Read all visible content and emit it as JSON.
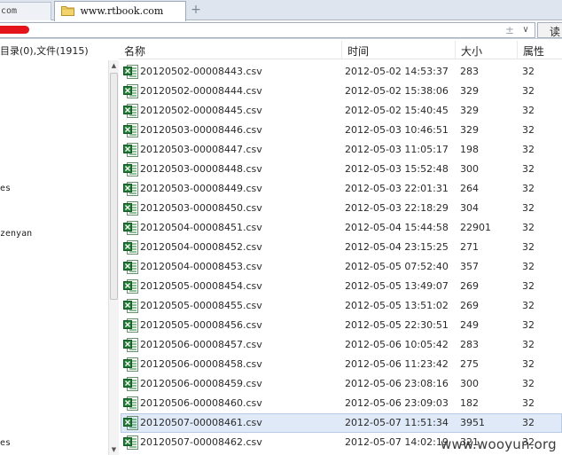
{
  "tabs": {
    "prev_label": "com",
    "active_label": "www.rtbook.com",
    "new_tab_symbol": "+"
  },
  "address_bar": {
    "plus_symbol": "±",
    "dropdown_symbol": "∨",
    "read_label": "读"
  },
  "left_pane": {
    "summary": "目录(0),文件(1915)",
    "tree_fragments": [
      "es",
      "zenyan",
      "es"
    ]
  },
  "columns": {
    "name": "名称",
    "time": "时间",
    "size": "大小",
    "attr": "属性"
  },
  "files": [
    {
      "name": "20120502-00008443.csv",
      "time": "2012-05-02 14:53:37",
      "size": "283",
      "attr": "32"
    },
    {
      "name": "20120502-00008444.csv",
      "time": "2012-05-02 15:38:06",
      "size": "329",
      "attr": "32"
    },
    {
      "name": "20120502-00008445.csv",
      "time": "2012-05-02 15:40:45",
      "size": "329",
      "attr": "32"
    },
    {
      "name": "20120503-00008446.csv",
      "time": "2012-05-03 10:46:51",
      "size": "329",
      "attr": "32"
    },
    {
      "name": "20120503-00008447.csv",
      "time": "2012-05-03 11:05:17",
      "size": "198",
      "attr": "32"
    },
    {
      "name": "20120503-00008448.csv",
      "time": "2012-05-03 15:52:48",
      "size": "300",
      "attr": "32"
    },
    {
      "name": "20120503-00008449.csv",
      "time": "2012-05-03 22:01:31",
      "size": "264",
      "attr": "32"
    },
    {
      "name": "20120503-00008450.csv",
      "time": "2012-05-03 22:18:29",
      "size": "304",
      "attr": "32"
    },
    {
      "name": "20120504-00008451.csv",
      "time": "2012-05-04 15:44:58",
      "size": "22901",
      "attr": "32"
    },
    {
      "name": "20120504-00008452.csv",
      "time": "2012-05-04 23:15:25",
      "size": "271",
      "attr": "32"
    },
    {
      "name": "20120504-00008453.csv",
      "time": "2012-05-05 07:52:40",
      "size": "357",
      "attr": "32"
    },
    {
      "name": "20120505-00008454.csv",
      "time": "2012-05-05 13:49:07",
      "size": "269",
      "attr": "32"
    },
    {
      "name": "20120505-00008455.csv",
      "time": "2012-05-05 13:51:02",
      "size": "269",
      "attr": "32"
    },
    {
      "name": "20120505-00008456.csv",
      "time": "2012-05-05 22:30:51",
      "size": "249",
      "attr": "32"
    },
    {
      "name": "20120506-00008457.csv",
      "time": "2012-05-06 10:05:42",
      "size": "283",
      "attr": "32"
    },
    {
      "name": "20120506-00008458.csv",
      "time": "2012-05-06 11:23:42",
      "size": "275",
      "attr": "32"
    },
    {
      "name": "20120506-00008459.csv",
      "time": "2012-05-06 23:08:16",
      "size": "300",
      "attr": "32"
    },
    {
      "name": "20120506-00008460.csv",
      "time": "2012-05-06 23:09:03",
      "size": "182",
      "attr": "32"
    },
    {
      "name": "20120507-00008461.csv",
      "time": "2012-05-07 11:51:34",
      "size": "3951",
      "attr": "32",
      "selected": true
    },
    {
      "name": "20120507-00008462.csv",
      "time": "2012-05-07 14:02:19",
      "size": "321",
      "attr": "32"
    }
  ],
  "watermark": "www.wooyun.org",
  "colors": {
    "excel_green": "#1e7d32",
    "selection_bg": "#dfe9f7",
    "red_mark": "#e4141b"
  }
}
